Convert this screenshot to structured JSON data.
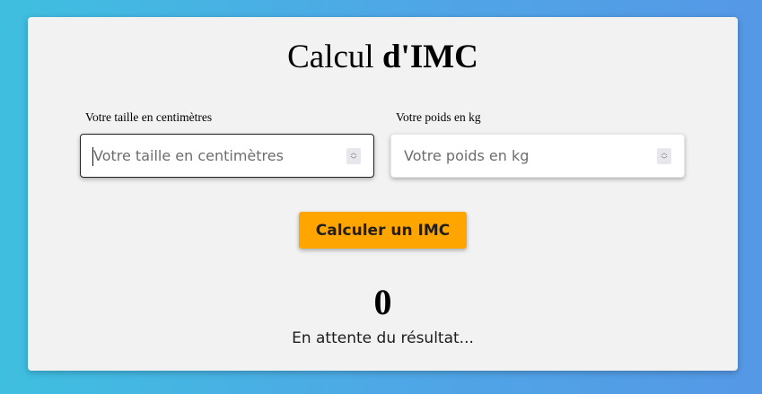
{
  "title": {
    "prefix": "Calcul",
    "strong": "d'IMC"
  },
  "form": {
    "height": {
      "label": "Votre taille en centimètres",
      "placeholder": "Votre taille en centimètres",
      "value": ""
    },
    "weight": {
      "label": "Votre poids en kg",
      "placeholder": "Votre poids en kg",
      "value": ""
    },
    "submit_label": "Calculer un IMC"
  },
  "result": {
    "value": "0",
    "status": "En attente du résultat..."
  },
  "colors": {
    "background_start": "#3fbfe0",
    "background_end": "#5598e6",
    "card": "#f2f2f3",
    "button": "#ffa500"
  },
  "icons": {
    "spinner": "number-stepper-icon"
  }
}
